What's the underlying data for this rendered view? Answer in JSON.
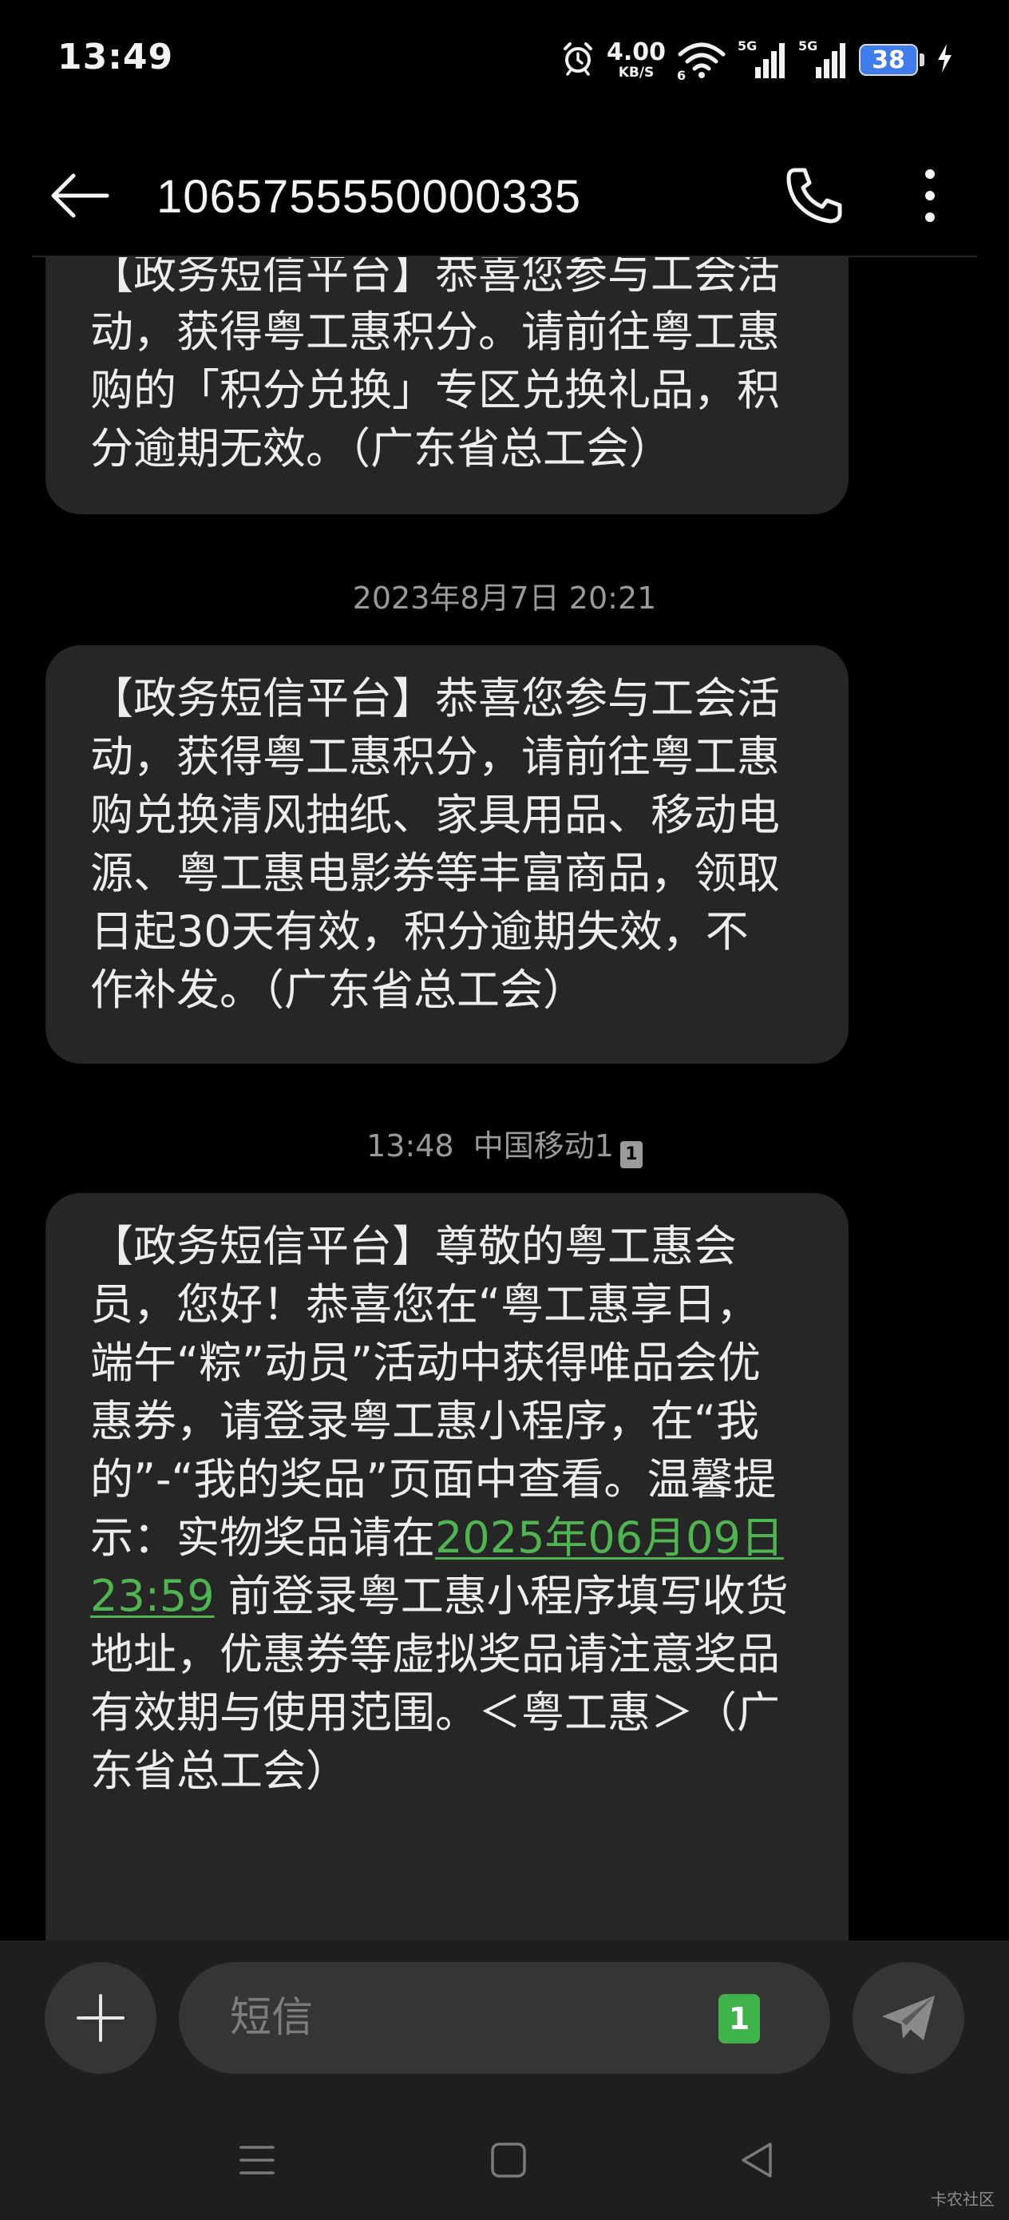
{
  "status_bar": {
    "time": "13:49",
    "net_speed_value": "4.00",
    "net_speed_unit": "KB/S",
    "wifi_label": "6",
    "signal_1_label": "5G",
    "signal_2_label": "5G",
    "battery_level": "38",
    "charging": true,
    "icons": [
      "alarm-icon",
      "wifi-icon",
      "signal-icon",
      "battery-icon",
      "charging-icon"
    ]
  },
  "header": {
    "contact": "1065755550000335",
    "icons": [
      "back-arrow-icon",
      "phone-icon",
      "more-vert-icon"
    ]
  },
  "messages": [
    {
      "lines": [
        "【政务短信平台】恭喜您参与工会活",
        "动，获得粤工惠积分。请前往粤工惠",
        "购的「积分兑换」专区兑换礼品，积",
        "分逾期无效。（广东省总工会）"
      ]
    },
    {
      "timestamp": "2023年8月7日 20:21",
      "lines": [
        "【政务短信平台】恭喜您参与工会活",
        "动，获得粤工惠积分，请前往粤工惠",
        "购兑换清风抽纸、家具用品、移动电",
        "源、粤工惠电影券等丰富商品，领取",
        "日起30天有效，积分逾期失效，不",
        "作补发。（广东省总工会）"
      ]
    },
    {
      "timestamp": "13:48  中国移动1",
      "sim_badge": "1",
      "lines": [
        "【政务短信平台】尊敬的粤工惠会",
        "员，您好！恭喜您在“粤工惠享日，",
        "端午“粽”动员”活动中获得唯品会优",
        "惠券，请登录粤工惠小程序，在“我",
        "的”-“我的奖品”页面中查看。温馨提"
      ],
      "line6_prefix": "示：实物奖品请在",
      "link_part1": "2025年06月09日",
      "link_part2": "23:59",
      "line7_suffix": " 前登录粤工惠小程序填写收货",
      "tail_lines": [
        "地址，优惠券等虚拟奖品请注意奖品",
        "有效期与使用范围。＜粤工惠＞（广",
        "东省总工会）"
      ]
    }
  ],
  "composer": {
    "placeholder": "短信",
    "sim_label": "1",
    "icons": [
      "plus-icon",
      "send-icon"
    ]
  },
  "nav_bar": {
    "icons": [
      "menu-icon",
      "home-icon",
      "back-triangle-icon"
    ]
  },
  "watermark": "卡农社区",
  "colors": {
    "background": "#000000",
    "bubble": "#262626",
    "link": "#4fb551",
    "sim_green": "#3fb24a",
    "battery_blue": "#3f7bea"
  }
}
